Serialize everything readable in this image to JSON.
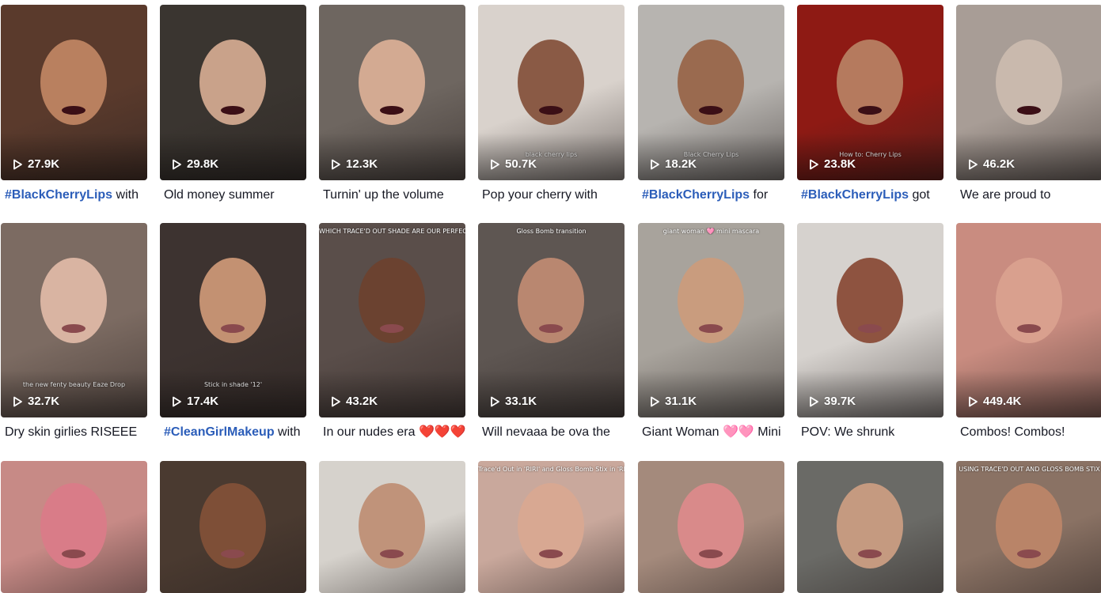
{
  "videos": [
    {
      "views": "27.9K",
      "hashtag": "#BlackCherryLips",
      "text": " with",
      "bg": "#5a3a2c",
      "skin": "#b9805f",
      "overlay": ""
    },
    {
      "views": "29.8K",
      "hashtag": "",
      "text": "Old money summer",
      "bg": "#3a3530",
      "skin": "#c9a28a",
      "overlay": ""
    },
    {
      "views": "12.3K",
      "hashtag": "",
      "text": "Turnin' up the volume",
      "bg": "#6e6660",
      "skin": "#d3aa92",
      "overlay": ""
    },
    {
      "views": "50.7K",
      "hashtag": "",
      "text": "Pop your cherry with",
      "bg": "#d9d2cc",
      "skin": "#8a5a45",
      "overlay": "black cherry lips"
    },
    {
      "views": "18.2K",
      "hashtag": "#BlackCherryLips",
      "text": " for",
      "bg": "#b7b4b0",
      "skin": "#9a6a4f",
      "overlay": "Black Cherry Lips"
    },
    {
      "views": "23.8K",
      "hashtag": "#BlackCherryLips",
      "text": " got",
      "bg": "#8e1a14",
      "skin": "#b57a5e",
      "overlay": "How to: Cherry Lips"
    },
    {
      "views": "46.2K",
      "hashtag": "",
      "text": "We are proud to",
      "bg": "#a89d96",
      "skin": "#c9b9ad",
      "overlay": ""
    },
    {
      "views": "32.7K",
      "hashtag": "",
      "text": "Dry skin girlies RISEEE",
      "bg": "#7c6b62",
      "skin": "#d9b4a2",
      "overlay": "the new fenty beauty Eaze Drop"
    },
    {
      "views": "17.4K",
      "hashtag": "#CleanGirlMakeup",
      "text": " with",
      "bg": "#3d3330",
      "skin": "#c39172",
      "overlay": "Stick in shade '12'"
    },
    {
      "views": "43.2K",
      "hashtag": "",
      "text": "In our nudes era ❤️❤️❤️❤️",
      "bg": "#5a4e4a",
      "skin": "#6b4230",
      "overlay": "WHICH TRACE'D OUT SHADE ARE OUR PERFECT NUDES?"
    },
    {
      "views": "33.1K",
      "hashtag": "",
      "text": "Will nevaaa be ova the",
      "bg": "#5e5652",
      "skin": "#b98770",
      "overlay": "Gloss Bomb transition"
    },
    {
      "views": "31.1K",
      "hashtag": "",
      "text": "Giant Woman 🩷🩷 Mini",
      "bg": "#a8a39c",
      "skin": "#c99c7e",
      "overlay": "giant woman 🩷 mini mascara"
    },
    {
      "views": "39.7K",
      "hashtag": "",
      "text": "POV: We shrunk",
      "bg": "#d6d2ce",
      "skin": "#8e5340",
      "overlay": ""
    },
    {
      "views": "449.4K",
      "hashtag": "",
      "text": "Combos! Combos!",
      "bg": "#c98c80",
      "skin": "#d9a08e",
      "overlay": ""
    },
    {
      "views": "",
      "hashtag": "",
      "text": "",
      "bg": "#c78a86",
      "skin": "#d97c88",
      "overlay": ""
    },
    {
      "views": "",
      "hashtag": "",
      "text": "",
      "bg": "#4a3a30",
      "skin": "#7e4f37",
      "overlay": ""
    },
    {
      "views": "",
      "hashtag": "",
      "text": "",
      "bg": "#d6d2cc",
      "skin": "#c0937a",
      "overlay": ""
    },
    {
      "views": "",
      "hashtag": "",
      "text": "",
      "bg": "#c9a89c",
      "skin": "#d8a892",
      "overlay": "Trace'd Out in 'RIRI' and Gloss Bomb Stix in 'RIRI'"
    },
    {
      "views": "",
      "hashtag": "",
      "text": "",
      "bg": "#a48a7c",
      "skin": "#d98a8a",
      "overlay": ""
    },
    {
      "views": "",
      "hashtag": "",
      "text": "",
      "bg": "#6a6a66",
      "skin": "#c59a80",
      "overlay": ""
    },
    {
      "views": "",
      "hashtag": "",
      "text": "",
      "bg": "#8a7264",
      "skin": "#b98468",
      "overlay": "USING TRACE'D OUT AND GLOSS BOMB STIX"
    }
  ],
  "icons": {
    "play": "play-icon"
  }
}
